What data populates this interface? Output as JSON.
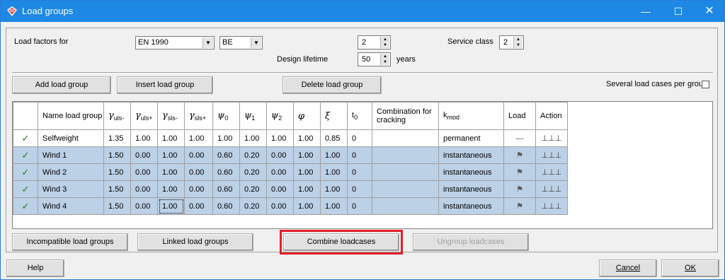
{
  "window": {
    "title": "Load groups",
    "minimize": "—",
    "maximize": "☐",
    "close": "✕"
  },
  "settings": {
    "load_factors_label": "Load factors for",
    "standard_value": "EN 1990",
    "country_value": "BE",
    "value_a": "2",
    "design_lifetime_label": "Design lifetime",
    "design_lifetime_value": "50",
    "years_label": "years",
    "service_class_label": "Service class",
    "service_class_value": "2"
  },
  "toolbar": {
    "add": "Add load group",
    "insert": "Insert load group",
    "delete": "Delete load group",
    "several_label": "Several load cases per group"
  },
  "grid": {
    "headers": {
      "name": "Name load group",
      "g1": "γ",
      "g1s": "uls-",
      "g2": "γ",
      "g2s": "uls+",
      "g3": "γ",
      "g3s": "sls-",
      "g4": "γ",
      "g4s": "sls+",
      "p0": "ψ",
      "p0s": "0",
      "p1": "ψ",
      "p1s": "1",
      "p2": "ψ",
      "p2s": "2",
      "phi": "φ",
      "xi": "ξ",
      "t": "t",
      "ts": "0",
      "comb": "Combination for cracking",
      "k": "k",
      "ks": "mod",
      "load": "Load",
      "action": "Action"
    },
    "rows": [
      {
        "check": "✓",
        "name": "Selfweight",
        "g1": "1.35",
        "g2": "1.00",
        "g3": "1.00",
        "g4": "1.00",
        "p0": "1.00",
        "p1": "1.00",
        "p2": "1.00",
        "phi": "1.00",
        "xi": "0.85",
        "t": "0",
        "comb": "",
        "k": "permanent",
        "load": "—",
        "action": "⊥⊥⊥"
      },
      {
        "check": "✓",
        "name": "Wind 1",
        "g1": "1.50",
        "g2": "0.00",
        "g3": "1.00",
        "g4": "0.00",
        "p0": "0.60",
        "p1": "0.20",
        "p2": "0.00",
        "phi": "1.00",
        "xi": "1.00",
        "t": "0",
        "comb": "",
        "k": "instantaneous",
        "load": "⚑",
        "action": "⊥⊥⊥"
      },
      {
        "check": "✓",
        "name": "Wind 2",
        "g1": "1.50",
        "g2": "0.00",
        "g3": "1.00",
        "g4": "0.00",
        "p0": "0.60",
        "p1": "0.20",
        "p2": "0.00",
        "phi": "1.00",
        "xi": "1.00",
        "t": "0",
        "comb": "",
        "k": "instantaneous",
        "load": "⚑",
        "action": "⊥⊥⊥"
      },
      {
        "check": "✓",
        "name": "Wind 3",
        "g1": "1.50",
        "g2": "0.00",
        "g3": "1.00",
        "g4": "0.00",
        "p0": "0.60",
        "p1": "0.20",
        "p2": "0.00",
        "phi": "1.00",
        "xi": "1.00",
        "t": "0",
        "comb": "",
        "k": "instantaneous",
        "load": "⚑",
        "action": "⊥⊥⊥"
      },
      {
        "check": "✓",
        "name": "Wind 4",
        "g1": "1.50",
        "g2": "0.00",
        "g3": "1.00",
        "g4": "0.00",
        "p0": "0.60",
        "p1": "0.20",
        "p2": "0.00",
        "phi": "1.00",
        "xi": "1.00",
        "t": "0",
        "comb": "",
        "k": "instantaneous",
        "load": "⚑",
        "action": "⊥⊥⊥"
      }
    ]
  },
  "bottom_buttons": {
    "incompatible": "Incompatible load groups",
    "linked": "Linked load groups",
    "combine": "Combine loadcases",
    "ungroup": "Ungroup loadcases"
  },
  "footer": {
    "help": "Help",
    "cancel": "Cancel",
    "ok": "OK"
  },
  "colors": {
    "titlebar": "#1e88e5",
    "selected_row": "#bcd0e6",
    "highlight": "#e3202a",
    "check": "#1a7a1a"
  }
}
